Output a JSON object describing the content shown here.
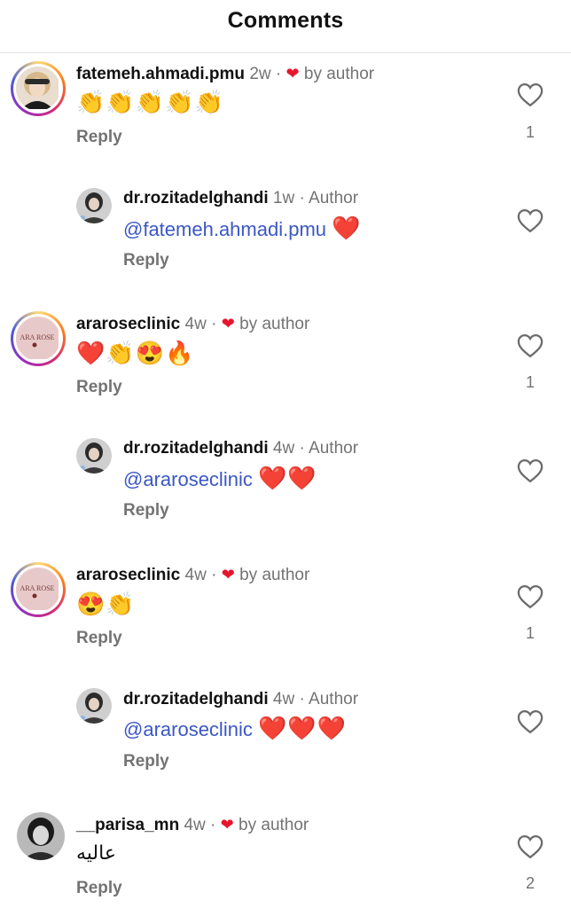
{
  "header": {
    "title": "Comments"
  },
  "comments": [
    {
      "username": "fatemeh.ahmadi.pmu",
      "time": "2w",
      "sep": "·",
      "badge": "by author",
      "text": "👏👏👏👏👏",
      "reply_label": "Reply",
      "likes": "1",
      "avatar": "profile-photo-woman-blonde"
    },
    {
      "username": "dr.rozitadelghandi",
      "time": "1w",
      "sep": "·",
      "role": "Author",
      "mention": "@fatemeh.ahmadi.pmu",
      "text": "❤️",
      "reply_label": "Reply",
      "avatar": "profile-photo-author"
    },
    {
      "username": "araroseclinic",
      "time": "4w",
      "sep": "·",
      "badge": "by author",
      "text": "❤️👏😍🔥",
      "reply_label": "Reply",
      "likes": "1",
      "avatar": "clinic-logo",
      "logo_text": "ARA ROSE"
    },
    {
      "username": "dr.rozitadelghandi",
      "time": "4w",
      "sep": "·",
      "role": "Author",
      "mention": "@araroseclinic",
      "text": "❤️❤️",
      "reply_label": "Reply",
      "avatar": "profile-photo-author"
    },
    {
      "username": "araroseclinic",
      "time": "4w",
      "sep": "·",
      "badge": "by author",
      "text": "😍👏",
      "reply_label": "Reply",
      "likes": "1",
      "avatar": "clinic-logo",
      "logo_text": "ARA ROSE"
    },
    {
      "username": "dr.rozitadelghandi",
      "time": "4w",
      "sep": "·",
      "role": "Author",
      "mention": "@araroseclinic",
      "text": "❤️❤️❤️",
      "reply_label": "Reply",
      "avatar": "profile-photo-author"
    },
    {
      "username": "__parisa_mn",
      "time": "4w",
      "sep": "·",
      "badge": "by author",
      "text": "عاليه",
      "reply_label": "Reply",
      "likes": "2",
      "avatar": "profile-photo-woman-grayscale"
    }
  ],
  "colors": {
    "mention": "#3b57c4",
    "muted": "#737373",
    "heart": "#e8142c"
  },
  "icons": {
    "like": "heart-outline-icon",
    "author_like": "heart-filled-icon"
  }
}
